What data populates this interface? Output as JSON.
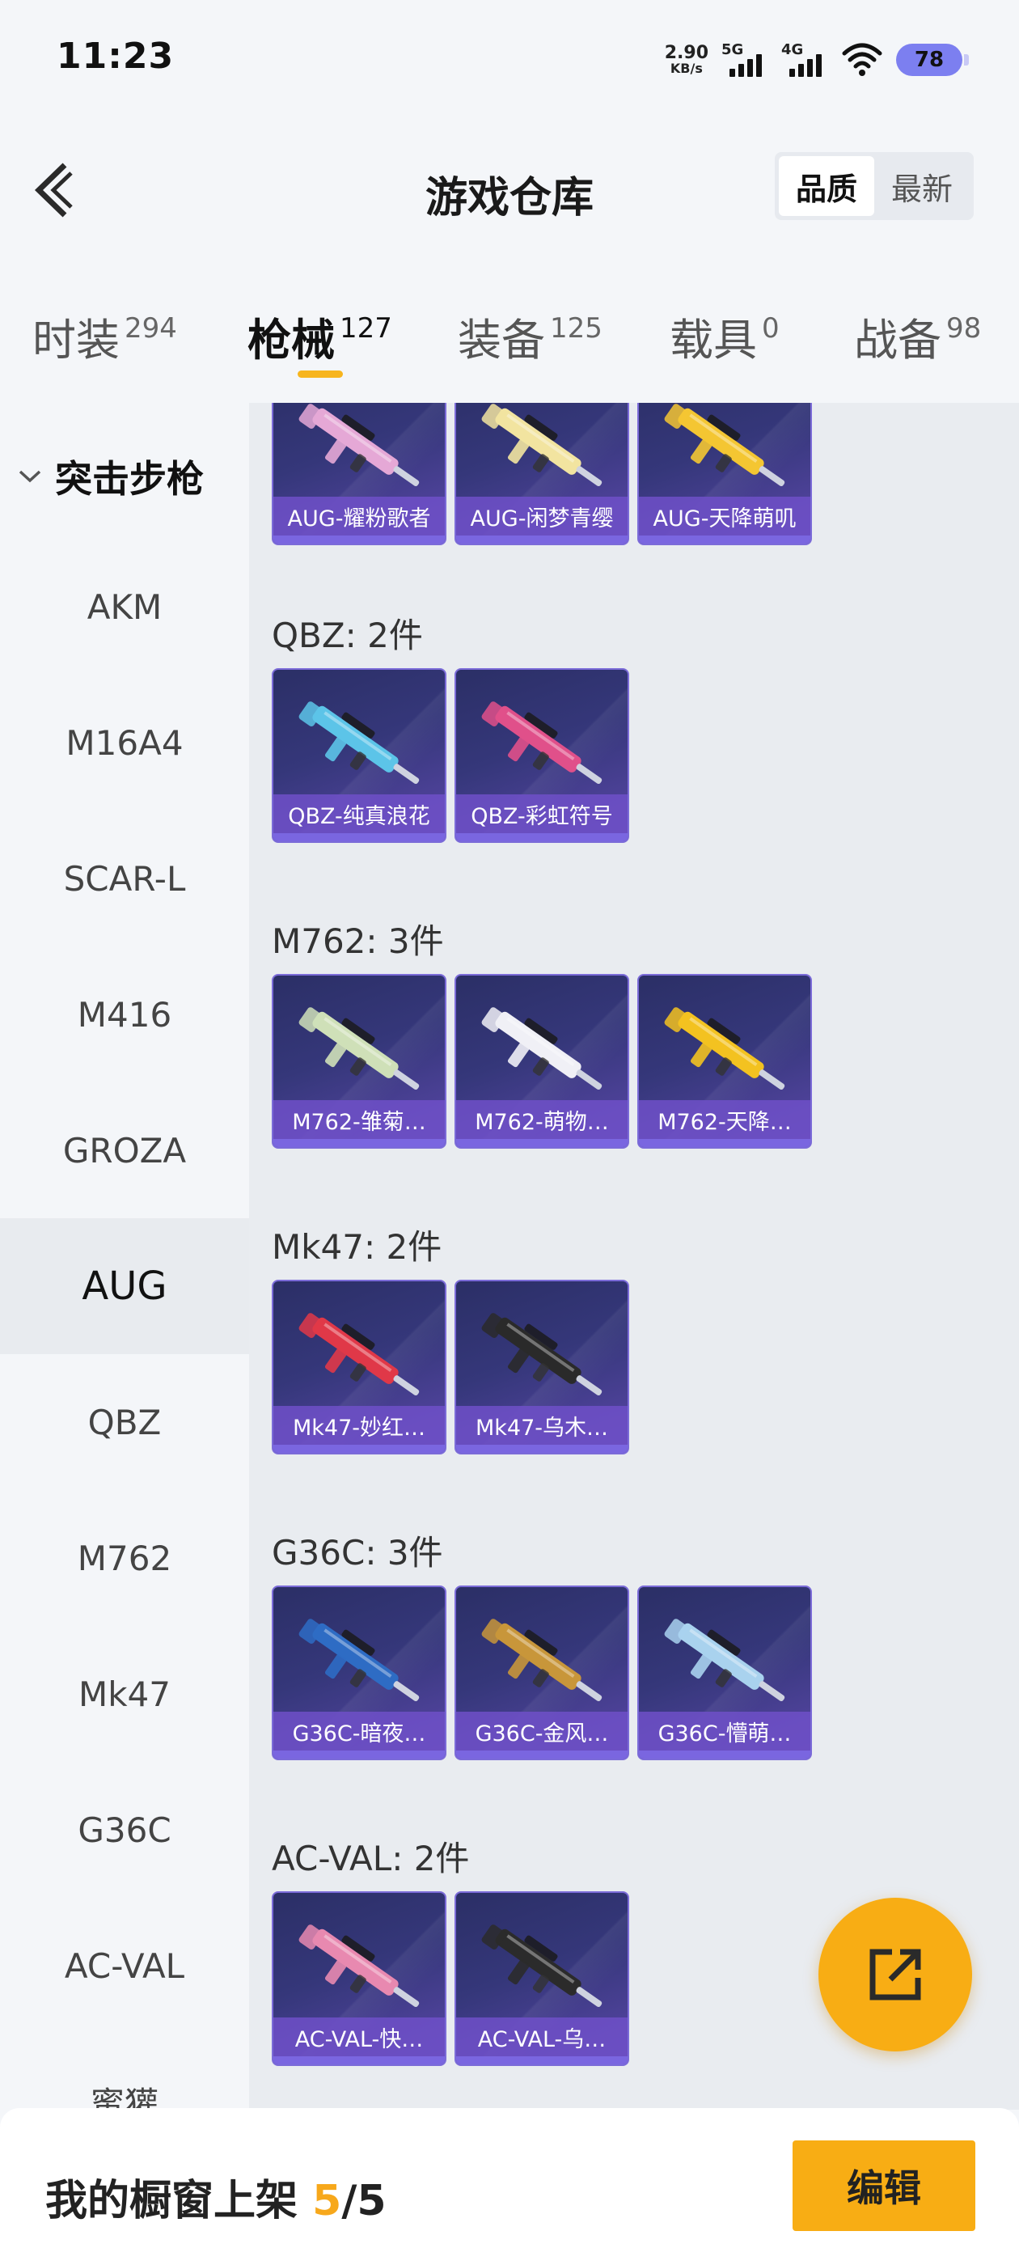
{
  "status_bar": {
    "time": "11:23",
    "net_speed_value": "2.90",
    "net_speed_unit": "KB/s",
    "signal_1_label": "5G",
    "signal_2_label": "4G",
    "battery": "78"
  },
  "header": {
    "title": "游戏仓库",
    "sort_options": [
      "品质",
      "最新"
    ],
    "sort_active": "品质"
  },
  "tabs": [
    {
      "label": "时装",
      "count": "294"
    },
    {
      "label": "枪械",
      "count": "127",
      "active": true
    },
    {
      "label": "装备",
      "count": "125"
    },
    {
      "label": "载具",
      "count": "0"
    },
    {
      "label": "战备",
      "count": "98"
    }
  ],
  "sidebar": {
    "group_label": "突击步枪",
    "items": [
      "AKM",
      "M16A4",
      "SCAR-L",
      "M416",
      "GROZA",
      "AUG",
      "QBZ",
      "M762",
      "Mk47",
      "G36C",
      "AC-VAL",
      "蜜獾"
    ],
    "active": "AUG"
  },
  "sections": [
    {
      "title": "",
      "items": [
        "AUG-耀粉歌者",
        "AUG-闲梦青缨",
        "AUG-天降萌叽"
      ],
      "colors": [
        "#e5a8d6",
        "#f2e4a0",
        "#f4c632"
      ]
    },
    {
      "title": "QBZ: 2件",
      "items": [
        "QBZ-纯真浪花",
        "QBZ-彩虹符号"
      ],
      "colors": [
        "#5cc4e8",
        "#e0508a"
      ]
    },
    {
      "title": "M762: 3件",
      "items": [
        "M762-雏菊…",
        "M762-萌物…",
        "M762-天降…"
      ],
      "colors": [
        "#cfe0b8",
        "#f0f0f6",
        "#f3c220"
      ]
    },
    {
      "title": "Mk47: 2件",
      "items": [
        "Mk47-妙红…",
        "Mk47-乌木…"
      ],
      "colors": [
        "#e03848",
        "#2a2a2a"
      ]
    },
    {
      "title": "G36C: 3件",
      "items": [
        "G36C-暗夜…",
        "G36C-金风…",
        "G36C-懵萌…"
      ],
      "colors": [
        "#2e6cc4",
        "#c8963a",
        "#a9d2ee"
      ]
    },
    {
      "title": "AC-VAL: 2件",
      "items": [
        "AC-VAL-快…",
        "AC-VAL-乌…"
      ],
      "colors": [
        "#e889b0",
        "#2b2b2b"
      ]
    }
  ],
  "bottom_bar": {
    "shop_label": "我的橱窗上架",
    "shop_count": "5",
    "shop_sep": "/",
    "shop_total": "5",
    "edit_label": "编辑"
  },
  "icons": {
    "back": "back-chevron-icon",
    "share": "share-external-icon",
    "group_toggle": "chevron-down-icon"
  },
  "colors": {
    "accent": "#f8ad14",
    "card_bg": "#35377a",
    "card_label": "#6e50c8"
  }
}
